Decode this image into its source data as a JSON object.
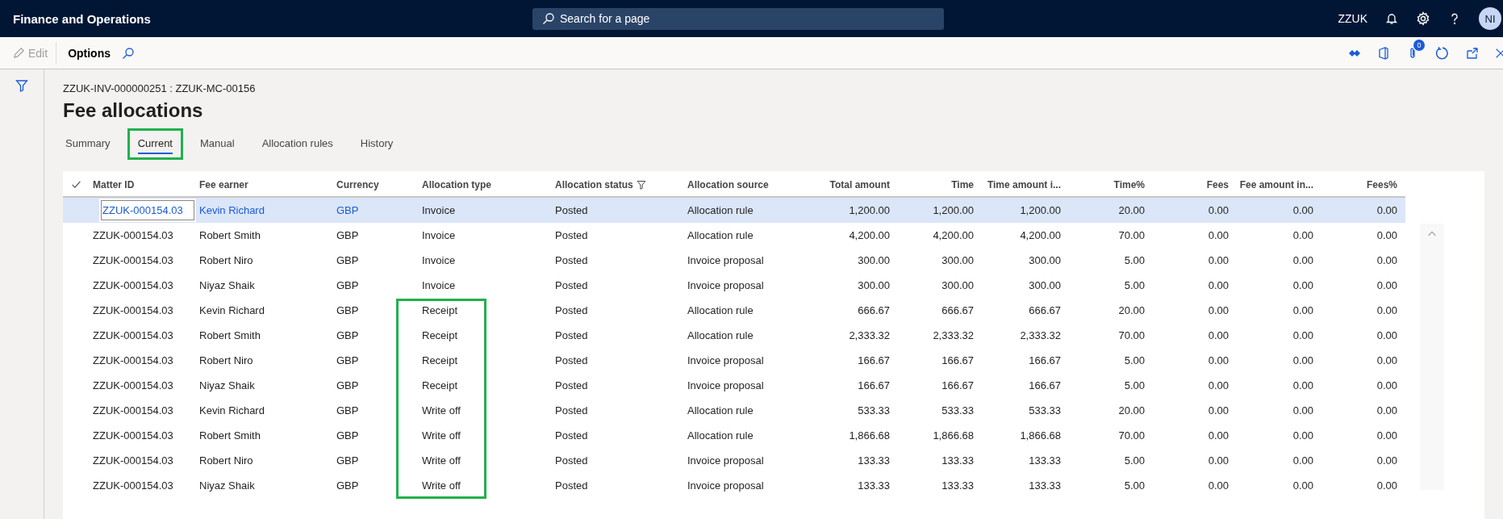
{
  "app": {
    "title": "Finance and Operations",
    "search_placeholder": "Search for a page",
    "company": "ZZUK",
    "avatar": "NI"
  },
  "toolbar": {
    "edit": {
      "label": "Edit",
      "disabled": true
    },
    "options": "Options",
    "attachments_count": "0"
  },
  "page": {
    "breadcrumb": "ZZUK-INV-000000251 : ZZUK-MC-00156",
    "title": "Fee allocations"
  },
  "tabs": [
    {
      "label": "Summary",
      "selected": false,
      "highlighted": false
    },
    {
      "label": "Current",
      "selected": true,
      "highlighted": true
    },
    {
      "label": "Manual",
      "selected": false,
      "highlighted": false
    },
    {
      "label": "Allocation rules",
      "selected": false,
      "highlighted": false
    },
    {
      "label": "History",
      "selected": false,
      "highlighted": false
    }
  ],
  "table": {
    "columns": [
      {
        "label": "Matter ID",
        "kind": "link",
        "filtered": false
      },
      {
        "label": "Fee earner",
        "kind": "link",
        "filtered": false
      },
      {
        "label": "Currency",
        "kind": "link",
        "filtered": false
      },
      {
        "label": "Allocation type",
        "kind": "text",
        "filtered": false
      },
      {
        "label": "Allocation status",
        "kind": "text",
        "filtered": true
      },
      {
        "label": "Allocation source",
        "kind": "text",
        "filtered": false
      },
      {
        "label": "Total amount",
        "kind": "number",
        "filtered": false
      },
      {
        "label": "Time",
        "kind": "number",
        "filtered": false
      },
      {
        "label": "Time amount i...",
        "kind": "number",
        "filtered": false
      },
      {
        "label": "Time%",
        "kind": "number",
        "filtered": false
      },
      {
        "label": "Fees",
        "kind": "number",
        "filtered": false
      },
      {
        "label": "Fee amount in...",
        "kind": "number",
        "filtered": false
      },
      {
        "label": "Fees%",
        "kind": "number",
        "filtered": false
      }
    ],
    "rows": [
      {
        "selected": true,
        "type_highlighted": false,
        "cells": [
          "ZZUK-000154.03",
          "Kevin Richard",
          "GBP",
          "Invoice",
          "Posted",
          "Allocation rule",
          "1,200.00",
          "1,200.00",
          "1,200.00",
          "20.00",
          "0.00",
          "0.00",
          "0.00"
        ]
      },
      {
        "selected": false,
        "type_highlighted": false,
        "cells": [
          "ZZUK-000154.03",
          "Robert Smith",
          "GBP",
          "Invoice",
          "Posted",
          "Allocation rule",
          "4,200.00",
          "4,200.00",
          "4,200.00",
          "70.00",
          "0.00",
          "0.00",
          "0.00"
        ]
      },
      {
        "selected": false,
        "type_highlighted": false,
        "cells": [
          "ZZUK-000154.03",
          "Robert Niro",
          "GBP",
          "Invoice",
          "Posted",
          "Invoice proposal",
          "300.00",
          "300.00",
          "300.00",
          "5.00",
          "0.00",
          "0.00",
          "0.00"
        ]
      },
      {
        "selected": false,
        "type_highlighted": false,
        "cells": [
          "ZZUK-000154.03",
          "Niyaz Shaik",
          "GBP",
          "Invoice",
          "Posted",
          "Invoice proposal",
          "300.00",
          "300.00",
          "300.00",
          "5.00",
          "0.00",
          "0.00",
          "0.00"
        ]
      },
      {
        "selected": false,
        "type_highlighted": true,
        "cells": [
          "ZZUK-000154.03",
          "Kevin Richard",
          "GBP",
          "Receipt",
          "Posted",
          "Allocation rule",
          "666.67",
          "666.67",
          "666.67",
          "20.00",
          "0.00",
          "0.00",
          "0.00"
        ]
      },
      {
        "selected": false,
        "type_highlighted": true,
        "cells": [
          "ZZUK-000154.03",
          "Robert Smith",
          "GBP",
          "Receipt",
          "Posted",
          "Allocation rule",
          "2,333.32",
          "2,333.32",
          "2,333.32",
          "70.00",
          "0.00",
          "0.00",
          "0.00"
        ]
      },
      {
        "selected": false,
        "type_highlighted": true,
        "cells": [
          "ZZUK-000154.03",
          "Robert Niro",
          "GBP",
          "Receipt",
          "Posted",
          "Invoice proposal",
          "166.67",
          "166.67",
          "166.67",
          "5.00",
          "0.00",
          "0.00",
          "0.00"
        ]
      },
      {
        "selected": false,
        "type_highlighted": true,
        "cells": [
          "ZZUK-000154.03",
          "Niyaz Shaik",
          "GBP",
          "Receipt",
          "Posted",
          "Invoice proposal",
          "166.67",
          "166.67",
          "166.67",
          "5.00",
          "0.00",
          "0.00",
          "0.00"
        ]
      },
      {
        "selected": false,
        "type_highlighted": true,
        "cells": [
          "ZZUK-000154.03",
          "Kevin Richard",
          "GBP",
          "Write off",
          "Posted",
          "Allocation rule",
          "533.33",
          "533.33",
          "533.33",
          "20.00",
          "0.00",
          "0.00",
          "0.00"
        ]
      },
      {
        "selected": false,
        "type_highlighted": true,
        "cells": [
          "ZZUK-000154.03",
          "Robert Smith",
          "GBP",
          "Write off",
          "Posted",
          "Allocation rule",
          "1,866.68",
          "1,866.68",
          "1,866.68",
          "70.00",
          "0.00",
          "0.00",
          "0.00"
        ]
      },
      {
        "selected": false,
        "type_highlighted": true,
        "cells": [
          "ZZUK-000154.03",
          "Robert Niro",
          "GBP",
          "Write off",
          "Posted",
          "Invoice proposal",
          "133.33",
          "133.33",
          "133.33",
          "5.00",
          "0.00",
          "0.00",
          "0.00"
        ]
      },
      {
        "selected": false,
        "type_highlighted": true,
        "cells": [
          "ZZUK-000154.03",
          "Niyaz Shaik",
          "GBP",
          "Write off",
          "Posted",
          "Invoice proposal",
          "133.33",
          "133.33",
          "133.33",
          "5.00",
          "0.00",
          "0.00",
          "0.00"
        ]
      }
    ]
  }
}
